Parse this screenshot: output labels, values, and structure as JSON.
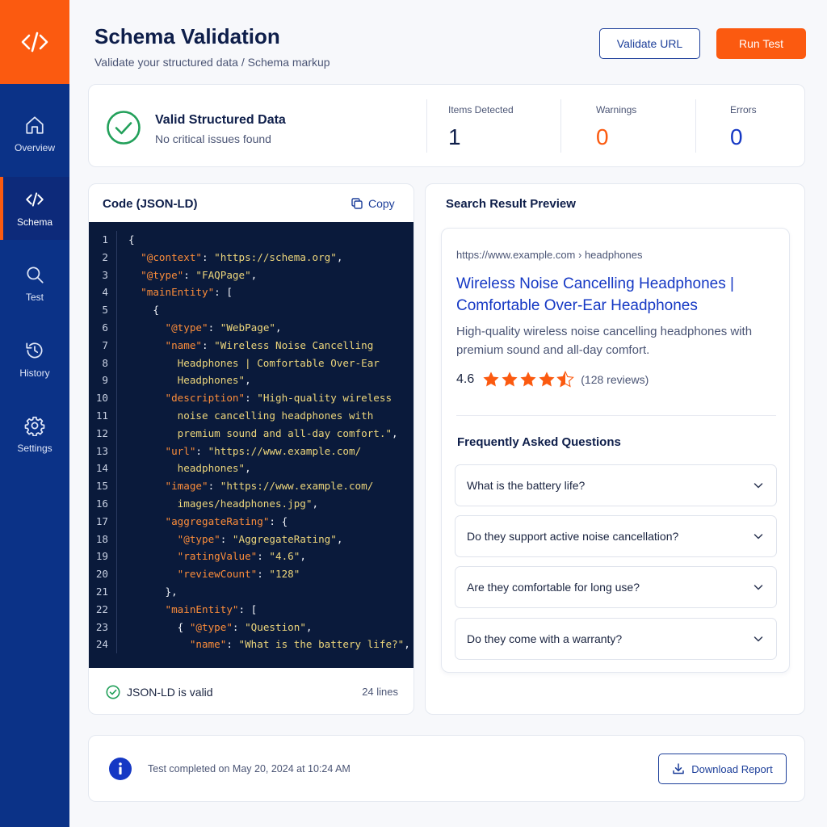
{
  "colors": {
    "accent": "#fb5a10",
    "primary": "#0b3287",
    "success": "#22a05a",
    "link": "#1538c4",
    "star": "#fb5a10"
  },
  "sidebar": {
    "logo_icon": "code-icon",
    "items": [
      {
        "label": "Overview",
        "icon": "home-icon",
        "active": false
      },
      {
        "label": "Schema",
        "icon": "code-icon",
        "active": true
      },
      {
        "label": "Test",
        "icon": "search-icon",
        "active": false
      },
      {
        "label": "History",
        "icon": "history-icon",
        "active": false
      },
      {
        "label": "Settings",
        "icon": "gear-icon",
        "active": false
      }
    ]
  },
  "header": {
    "title": "Schema Validation",
    "subtitle": "Validate your structured data / Schema markup",
    "validate_label": "Validate URL",
    "run_label": "Run Test"
  },
  "summary": {
    "status_title": "Valid Structured Data",
    "status_desc": "No critical issues found",
    "stats": [
      {
        "label": "Items Detected",
        "value": "1",
        "color": "#0e1e4a"
      },
      {
        "label": "Warnings",
        "value": "0",
        "color": "#fb5a10"
      },
      {
        "label": "Errors",
        "value": "0",
        "color": "#1538c4"
      }
    ]
  },
  "code": {
    "title": "Code (JSON-LD)",
    "copy_label": "Copy",
    "lines": [
      [
        [
          "p",
          "{"
        ]
      ],
      [
        [
          "p",
          "  "
        ],
        [
          "k",
          "\"@context\""
        ],
        [
          "p",
          ": "
        ],
        [
          "s",
          "\"https://schema.org\""
        ],
        [
          "p",
          ","
        ]
      ],
      [
        [
          "p",
          "  "
        ],
        [
          "k",
          "\"@type\""
        ],
        [
          "p",
          ": "
        ],
        [
          "s",
          "\"FAQPage\""
        ],
        [
          "p",
          ","
        ]
      ],
      [
        [
          "p",
          "  "
        ],
        [
          "k",
          "\"mainEntity\""
        ],
        [
          "p",
          ": ["
        ]
      ],
      [
        [
          "p",
          "    {"
        ]
      ],
      [
        [
          "p",
          "      "
        ],
        [
          "k",
          "\"@type\""
        ],
        [
          "p",
          ": "
        ],
        [
          "s",
          "\"WebPage\""
        ],
        [
          "p",
          ","
        ]
      ],
      [
        [
          "p",
          "      "
        ],
        [
          "k",
          "\"name\""
        ],
        [
          "p",
          ": "
        ],
        [
          "s",
          "\"Wireless Noise Cancelling"
        ]
      ],
      [
        [
          "s",
          "        Headphones | Comfortable Over-Ear"
        ]
      ],
      [
        [
          "s",
          "        Headphones\""
        ],
        [
          "p",
          ","
        ]
      ],
      [
        [
          "p",
          "      "
        ],
        [
          "k",
          "\"description\""
        ],
        [
          "p",
          ": "
        ],
        [
          "s",
          "\"High-quality wireless"
        ]
      ],
      [
        [
          "s",
          "        noise cancelling headphones with"
        ]
      ],
      [
        [
          "s",
          "        premium sound and all-day comfort.\""
        ],
        [
          "p",
          ","
        ]
      ],
      [
        [
          "p",
          "      "
        ],
        [
          "k",
          "\"url\""
        ],
        [
          "p",
          ": "
        ],
        [
          "s",
          "\"https://www.example.com/"
        ]
      ],
      [
        [
          "s",
          "        headphones\""
        ],
        [
          "p",
          ","
        ]
      ],
      [
        [
          "p",
          "      "
        ],
        [
          "k",
          "\"image\""
        ],
        [
          "p",
          ": "
        ],
        [
          "s",
          "\"https://www.example.com/"
        ]
      ],
      [
        [
          "s",
          "        images/headphones.jpg\""
        ],
        [
          "p",
          ","
        ]
      ],
      [
        [
          "p",
          "      "
        ],
        [
          "k",
          "\"aggregateRating\""
        ],
        [
          "p",
          ": {"
        ]
      ],
      [
        [
          "p",
          "        "
        ],
        [
          "k",
          "\"@type\""
        ],
        [
          "p",
          ": "
        ],
        [
          "s",
          "\"AggregateRating\""
        ],
        [
          "p",
          ","
        ]
      ],
      [
        [
          "p",
          "        "
        ],
        [
          "k",
          "\"ratingValue\""
        ],
        [
          "p",
          ": "
        ],
        [
          "s",
          "\"4.6\""
        ],
        [
          "p",
          ","
        ]
      ],
      [
        [
          "p",
          "        "
        ],
        [
          "k",
          "\"reviewCount\""
        ],
        [
          "p",
          ": "
        ],
        [
          "s",
          "\"128\""
        ]
      ],
      [
        [
          "p",
          "      },"
        ]
      ],
      [
        [
          "p",
          "      "
        ],
        [
          "k",
          "\"mainEntity\""
        ],
        [
          "p",
          ": ["
        ]
      ],
      [
        [
          "p",
          "        { "
        ],
        [
          "k",
          "\"@type\""
        ],
        [
          "p",
          ": "
        ],
        [
          "s",
          "\"Question\""
        ],
        [
          "p",
          ","
        ]
      ],
      [
        [
          "p",
          "          "
        ],
        [
          "k",
          "\"name\""
        ],
        [
          "p",
          ": "
        ],
        [
          "s",
          "\"What is the battery life?\""
        ],
        [
          "p",
          ","
        ]
      ]
    ],
    "valid_label": "JSON-LD is valid",
    "lines_count": "24 lines"
  },
  "preview": {
    "title": "Search Result Preview",
    "url": "https://www.example.com › headphones",
    "link": "Wireless Noise Cancelling Headphones | Comfortable Over-Ear Headphones",
    "description": "High-quality wireless noise cancelling headphones with premium sound and all-day comfort.",
    "rating": "4.6",
    "rating_stars": 4.5,
    "reviews": "(128 reviews)",
    "faq_title": "Frequently Asked Questions",
    "faqs": [
      "What is the battery life?",
      "Do they support active noise cancellation?",
      "Are they comfortable for long use?",
      "Do they come with a warranty?"
    ]
  },
  "footer": {
    "text": "Test completed on May 20, 2024 at 10:24 AM",
    "download_label": "Download Report"
  }
}
